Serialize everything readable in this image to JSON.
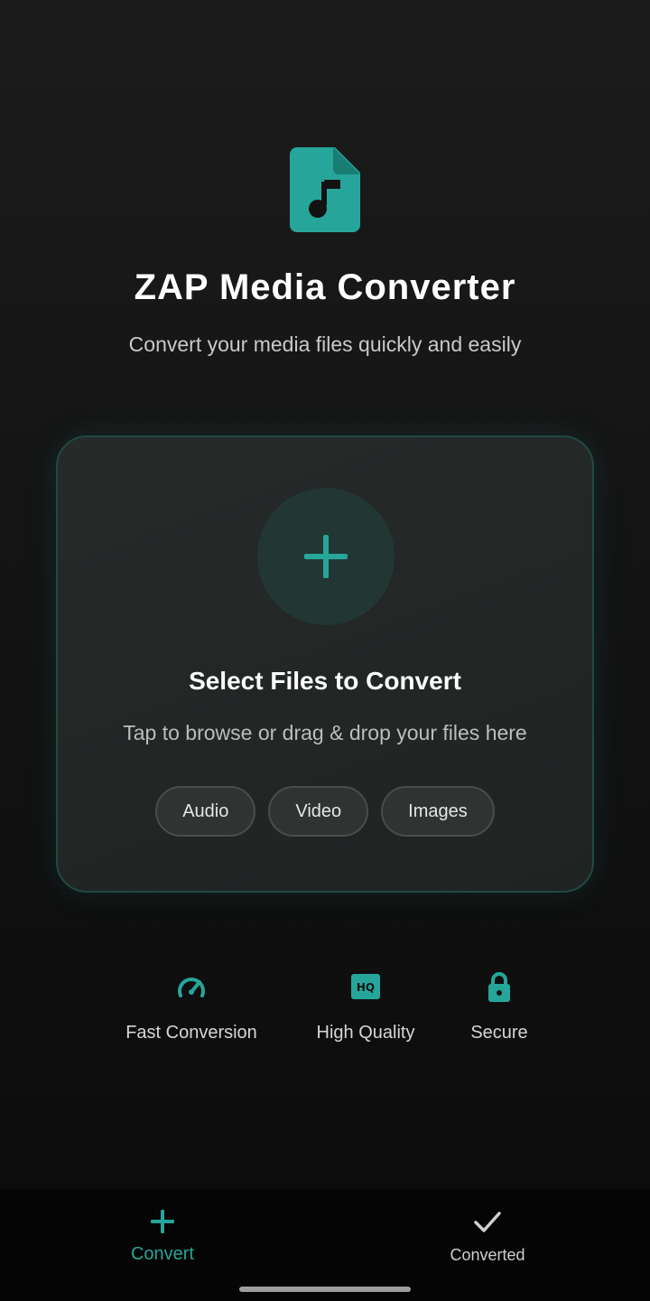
{
  "colors": {
    "accent": "#26a69a",
    "background": "#141414",
    "card": "#232726",
    "text_primary": "#ffffff",
    "text_secondary": "#bdbdbd"
  },
  "header": {
    "icon": "audio-file-icon",
    "title": "ZAP Media Converter",
    "subtitle": "Convert your media files quickly and easily"
  },
  "drop_card": {
    "icon": "plus-icon",
    "title": "Select Files to Convert",
    "description": "Tap to browse or drag & drop your files here",
    "chips": [
      {
        "label": "Audio"
      },
      {
        "label": "Video"
      },
      {
        "label": "Images"
      }
    ]
  },
  "features": [
    {
      "icon": "speedometer-icon",
      "label": "Fast Conversion"
    },
    {
      "icon": "hq-icon",
      "label": "High Quality"
    },
    {
      "icon": "lock-icon",
      "label": "Secure"
    }
  ],
  "bottom_nav": {
    "items": [
      {
        "icon": "plus-icon",
        "label": "Convert",
        "active": true
      },
      {
        "icon": "check-icon",
        "label": "Converted",
        "active": false
      }
    ]
  }
}
